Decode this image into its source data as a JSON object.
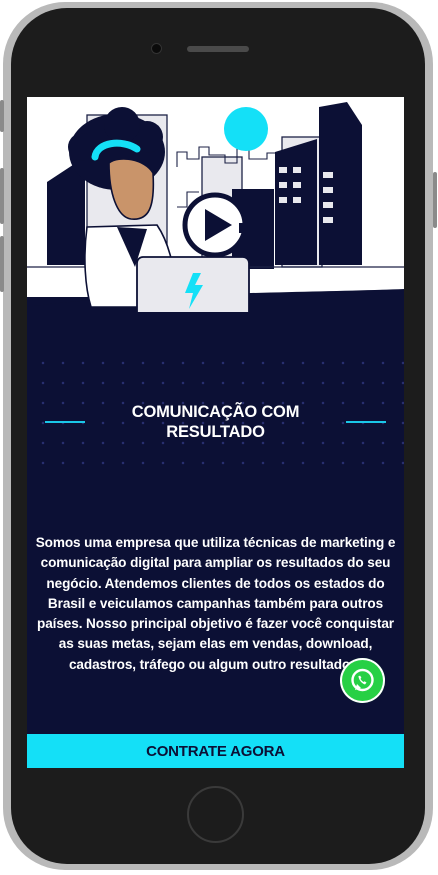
{
  "hero": {
    "image_icon": "illustration-person-laptop-city",
    "play_icon": "play-icon",
    "bolt_icon": "lightning-icon"
  },
  "section": {
    "title": "COMUNICAÇÃO COM RESULTADO"
  },
  "content": {
    "description": "Somos uma empresa que utiliza técnicas de marketing e comunicação digital para ampliar os resultados do seu negócio. Atendemos clientes de todos os estados do Brasil e veiculamos campanhas também para outros países. Nosso principal objetivo é fazer você conquistar as suas metas, sejam elas em vendas, download, cadastros, tráfego ou algum outro resultado d"
  },
  "whatsapp": {
    "icon": "whatsapp-icon"
  },
  "cta": {
    "label": "CONTRATE AGORA"
  },
  "colors": {
    "background": "#0c1035",
    "accent": "#14e0f7",
    "whatsapp": "#27d045",
    "text": "#ffffff"
  }
}
